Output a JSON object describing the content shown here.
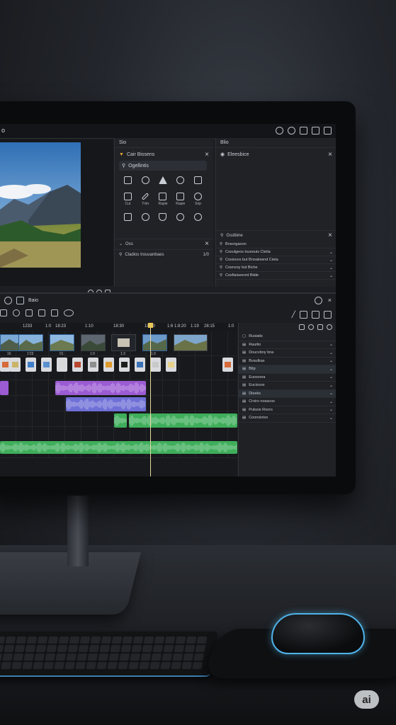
{
  "app": {
    "title": "o",
    "badge": "ai"
  },
  "panels": {
    "left_header": "Sio",
    "right_header": "Blio",
    "shapes": {
      "title": "Cair Bissens",
      "search_placeholder": "Ogellintis",
      "items": [
        {
          "icon": "grid-icon",
          "label": ""
        },
        {
          "icon": "circles-icon",
          "label": ""
        },
        {
          "icon": "triangle-icon",
          "label": ""
        },
        {
          "icon": "zoom-icon",
          "label": ""
        },
        {
          "icon": "window-icon",
          "label": ""
        },
        {
          "icon": "square-icon",
          "label": "Cut"
        },
        {
          "icon": "pen-icon",
          "label": "Trim"
        },
        {
          "icon": "page-icon",
          "label": "Rapie"
        },
        {
          "icon": "crop-icon",
          "label": "Rapie"
        },
        {
          "icon": "gear-icon",
          "label": "Srip"
        },
        {
          "icon": "square-icon",
          "label": ""
        },
        {
          "icon": "circle-icon",
          "label": ""
        },
        {
          "icon": "shield-icon",
          "label": ""
        },
        {
          "icon": "bubble-icon",
          "label": ""
        },
        {
          "icon": "search-icon",
          "label": ""
        }
      ],
      "section": "Oss",
      "subrow": "Cladios trouuanbaes",
      "subrow_value": "1/0"
    },
    "audio": {
      "title": "Eleesbice",
      "section": "Gsslbine",
      "rows": [
        "Bnsorgaoon",
        "Cosulgeos tsuoouis Cteila",
        "Cosisovs but Bnoalownd Cieta",
        "Cosnvoy tiut Biche",
        "Cosfiaiseeont Biide"
      ]
    }
  },
  "timeline": {
    "title": "Baio",
    "ruler": [
      "1233",
      "1:0",
      "18:23",
      "1:10",
      "18:30",
      "18:20",
      "1:6",
      "1:8:20",
      "1:19",
      "28:15",
      "1:0"
    ],
    "thumb_labels": [
      "16",
      "1'23",
      "01",
      "1:9",
      "1:3",
      "1.0"
    ],
    "properties": [
      "Rusiatis",
      "Rauitio",
      "Doucvbny bna",
      "Bvaulkas",
      "Bitp",
      "Euosvora",
      "Eucisoos",
      "Dieeks",
      "Croirs nosacos",
      "Pulssis Roors",
      "Coonsioivs"
    ]
  },
  "colors": {
    "accent": "#4fb3e8",
    "clip_purple": "#9b5bd3",
    "clip_blue": "#6f6fd8",
    "clip_green": "#3fae5b",
    "playhead": "#e8c757"
  }
}
